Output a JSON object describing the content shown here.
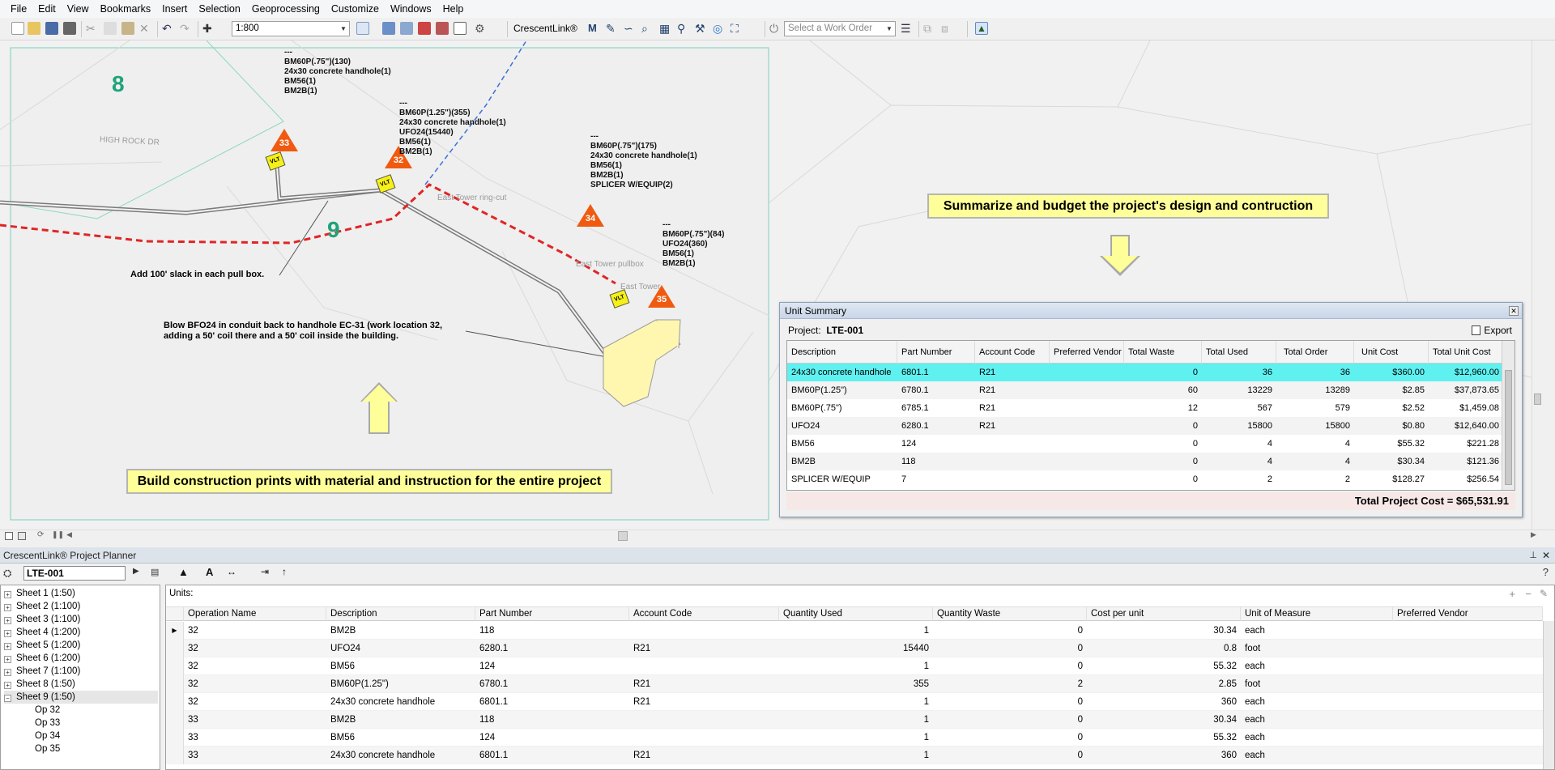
{
  "menu": [
    "File",
    "Edit",
    "View",
    "Bookmarks",
    "Insert",
    "Selection",
    "Geoprocessing",
    "Customize",
    "Windows",
    "Help"
  ],
  "toolbar": {
    "scale": "1:800",
    "crescentlink_label": "CrescentLink®",
    "work_order_placeholder": "Select a Work Order"
  },
  "map": {
    "zones": [
      "8",
      "9"
    ],
    "road_label": "HIGH ROCK DR",
    "points": [
      {
        "id": "33",
        "box": "VLT"
      },
      {
        "id": "32",
        "box": "VLT"
      },
      {
        "id": "34",
        "box": ""
      },
      {
        "id": "35",
        "box": "VLT"
      }
    ],
    "labels": {
      "op33": "---\nBM60P(.75\")(130)\n24x30 concrete handhole(1)\nBM56(1)\nBM2B(1)",
      "op32": "---\nBM60P(1.25\")(355)\n24x30 concrete handhole(1)\nUFO24(15440)\nBM56(1)\nBM2B(1)",
      "op34": "---\nBM60P(.75\")(175)\n24x30 concrete handhole(1)\nBM56(1)\nBM2B(1)\nSPLICER W/EQUIP(2)",
      "op35": "---\nBM60P(.75\")(84)\nUFO24(360)\nBM56(1)\nBM2B(1)"
    },
    "gray_labels": {
      "ringcut": "East Tower ring-cut",
      "pullbox": "East Tower pullbox",
      "tower": "East Tower"
    },
    "annotations": {
      "slack": "Add 100' slack in each pull box.",
      "blow": "Blow BFO24 in conduit back to handhole EC-31 (work location 32,\nadding a 50' coil there and a 50' coil inside the building."
    },
    "callouts": {
      "build": "Build construction prints with material and instruction for the entire project",
      "summarize": "Summarize and budget the project's design and contruction"
    }
  },
  "unit_summary": {
    "title": "Unit Summary",
    "project_label": "Project:",
    "project_value": "LTE-001",
    "export_label": "Export",
    "columns": [
      "Description",
      "Part Number",
      "Account Code",
      "Preferred Vendor",
      "Total Waste",
      "Total Used",
      "Total Order",
      "Unit Cost",
      "Total Unit Cost"
    ],
    "rows": [
      [
        "24x30 concrete handhole",
        "6801.1",
        "R21",
        "",
        "0",
        "36",
        "36",
        "$360.00",
        "$12,960.00"
      ],
      [
        "BM60P(1.25\")",
        "6780.1",
        "R21",
        "",
        "60",
        "13229",
        "13289",
        "$2.85",
        "$37,873.65"
      ],
      [
        "BM60P(.75\")",
        "6785.1",
        "R21",
        "",
        "12",
        "567",
        "579",
        "$2.52",
        "$1,459.08"
      ],
      [
        "UFO24",
        "6280.1",
        "R21",
        "",
        "0",
        "15800",
        "15800",
        "$0.80",
        "$12,640.00"
      ],
      [
        "BM56",
        "124",
        "",
        "",
        "0",
        "4",
        "4",
        "$55.32",
        "$221.28"
      ],
      [
        "BM2B",
        "118",
        "",
        "",
        "0",
        "4",
        "4",
        "$30.34",
        "$121.36"
      ],
      [
        "SPLICER W/EQUIP",
        "7",
        "",
        "",
        "0",
        "2",
        "2",
        "$128.27",
        "$256.54"
      ]
    ],
    "total_label": "Total Project Cost",
    "total_value": "$65,531.91"
  },
  "planner": {
    "title": "CrescentLink® Project Planner",
    "project_value": "LTE-001",
    "tree": [
      {
        "label": "Sheet 1 (1:50)",
        "expanded": false
      },
      {
        "label": "Sheet 2 (1:100)",
        "expanded": false
      },
      {
        "label": "Sheet 3 (1:100)",
        "expanded": false
      },
      {
        "label": "Sheet 4 (1:200)",
        "expanded": false
      },
      {
        "label": "Sheet 5 (1:200)",
        "expanded": false
      },
      {
        "label": "Sheet 6 (1:200)",
        "expanded": false
      },
      {
        "label": "Sheet 7 (1:100)",
        "expanded": false
      },
      {
        "label": "Sheet 8 (1:50)",
        "expanded": false
      },
      {
        "label": "Sheet 9 (1:50)",
        "expanded": true
      }
    ],
    "tree_children": [
      "Op 32",
      "Op 33",
      "Op 34",
      "Op 35"
    ],
    "units_label": "Units:",
    "columns": [
      "Operation Name",
      "Description",
      "Part Number",
      "Account Code",
      "Quantity Used",
      "Quantity Waste",
      "Cost per unit",
      "Unit of Measure",
      "Preferred Vendor"
    ],
    "rows": [
      [
        "32",
        "BM2B",
        "118",
        "",
        "1",
        "0",
        "30.34",
        "each",
        ""
      ],
      [
        "32",
        "UFO24",
        "6280.1",
        "R21",
        "15440",
        "0",
        "0.8",
        "foot",
        ""
      ],
      [
        "32",
        "BM56",
        "124",
        "",
        "1",
        "0",
        "55.32",
        "each",
        ""
      ],
      [
        "32",
        "BM60P(1.25\")",
        "6780.1",
        "R21",
        "355",
        "2",
        "2.85",
        "foot",
        ""
      ],
      [
        "32",
        "24x30 concrete handhole",
        "6801.1",
        "R21",
        "1",
        "0",
        "360",
        "each",
        ""
      ],
      [
        "33",
        "BM2B",
        "118",
        "",
        "1",
        "0",
        "30.34",
        "each",
        ""
      ],
      [
        "33",
        "BM56",
        "124",
        "",
        "1",
        "0",
        "55.32",
        "each",
        ""
      ],
      [
        "33",
        "24x30 concrete handhole",
        "6801.1",
        "R21",
        "1",
        "0",
        "360",
        "each",
        ""
      ]
    ]
  }
}
